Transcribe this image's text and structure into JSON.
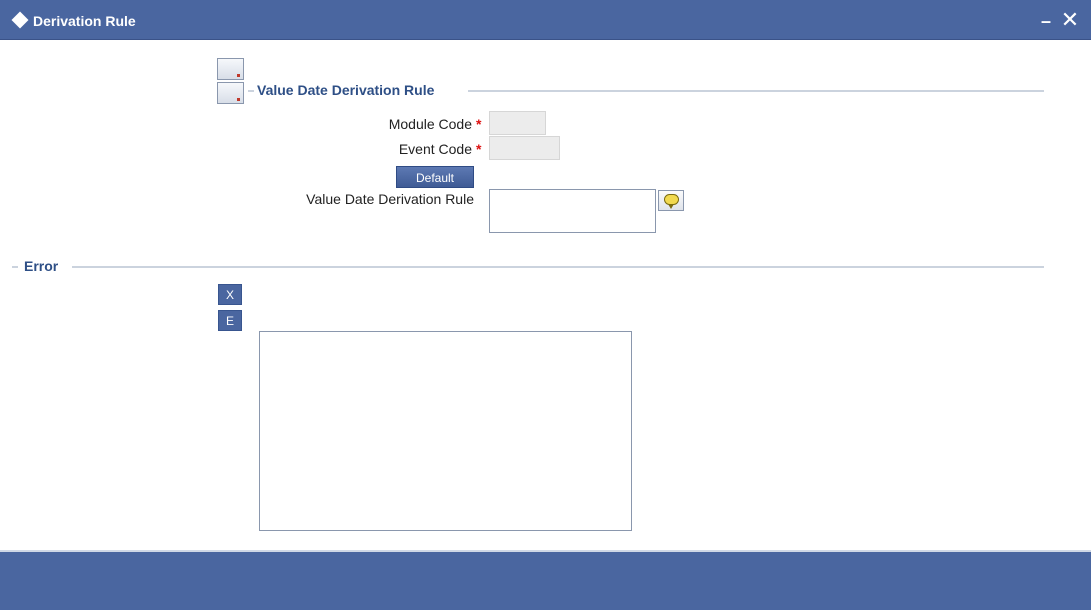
{
  "window": {
    "title": "Derivation Rule",
    "minimize_glyph": "–",
    "close_glyph": "✕"
  },
  "value_date_section": {
    "legend": "Value Date Derivation Rule",
    "module_code_label": "Module Code",
    "module_code_value": "",
    "event_code_label": "Event Code",
    "event_code_value": "",
    "required_marker": "*",
    "default_button": "Default",
    "rule_label": "Value Date Derivation Rule",
    "rule_value": ""
  },
  "error_section": {
    "legend": "Error",
    "x_button": "X",
    "e_button": "E",
    "error_text": ""
  },
  "colors": {
    "titlebar": "#4a66a0",
    "section_label": "#2e4f86",
    "required": "#dd1111"
  },
  "icons": [
    "diamond-icon",
    "minimize-icon",
    "close-icon",
    "toolbar-icon",
    "lov-bubble-icon"
  ]
}
